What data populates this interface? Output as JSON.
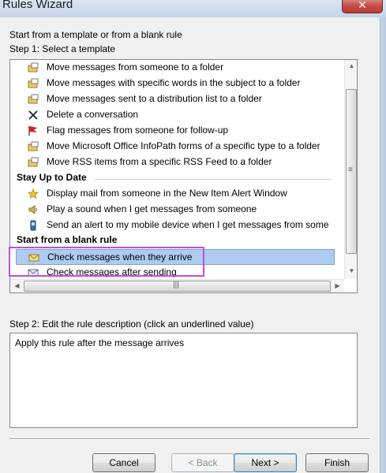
{
  "window": {
    "title": "Rules Wizard",
    "close_glyph": "✕"
  },
  "intro": "Start from a template or from a blank rule",
  "step1": "Step 1: Select a template",
  "templates": [
    {
      "icon": "folder-move-icon",
      "label": "Move messages from someone to a folder"
    },
    {
      "icon": "folder-move-icon",
      "label": "Move messages with specific words in the subject to a folder"
    },
    {
      "icon": "folder-move-icon",
      "label": "Move messages sent to a distribution list to a folder"
    },
    {
      "icon": "delete-x-icon",
      "label": "Delete a conversation"
    },
    {
      "icon": "red-flag-icon",
      "label": "Flag messages from someone for follow-up"
    },
    {
      "icon": "folder-move-icon",
      "label": "Move Microsoft Office InfoPath forms of a specific type to a folder"
    },
    {
      "icon": "folder-move-icon",
      "label": "Move RSS items from a specific RSS Feed to a folder"
    }
  ],
  "stay_up_header": "Stay Up to Date",
  "stay_up_items": [
    {
      "icon": "alert-star-icon",
      "label": "Display mail from someone in the New Item Alert Window"
    },
    {
      "icon": "speaker-icon",
      "label": "Play a sound when I get messages from someone"
    },
    {
      "icon": "mobile-device-icon",
      "label": "Send an alert to my mobile device when I get messages from some"
    }
  ],
  "blank_header": "Start from a blank rule",
  "blank_items": [
    {
      "icon": "envelope-icon",
      "label": "Check messages when they arrive",
      "selected": true
    },
    {
      "icon": "sent-envelope-icon",
      "label": "Check messages after sending",
      "selected": false
    }
  ],
  "step2": "Step 2: Edit the rule description (click an underlined value)",
  "description": "Apply this rule after the message arrives",
  "buttons": {
    "cancel": "Cancel",
    "back": "< Back",
    "next": "Next >",
    "finish": "Finish"
  },
  "colors": {
    "selection": "#aecbf0",
    "highlight_box": "#c050d8",
    "flag": "#d42020"
  }
}
